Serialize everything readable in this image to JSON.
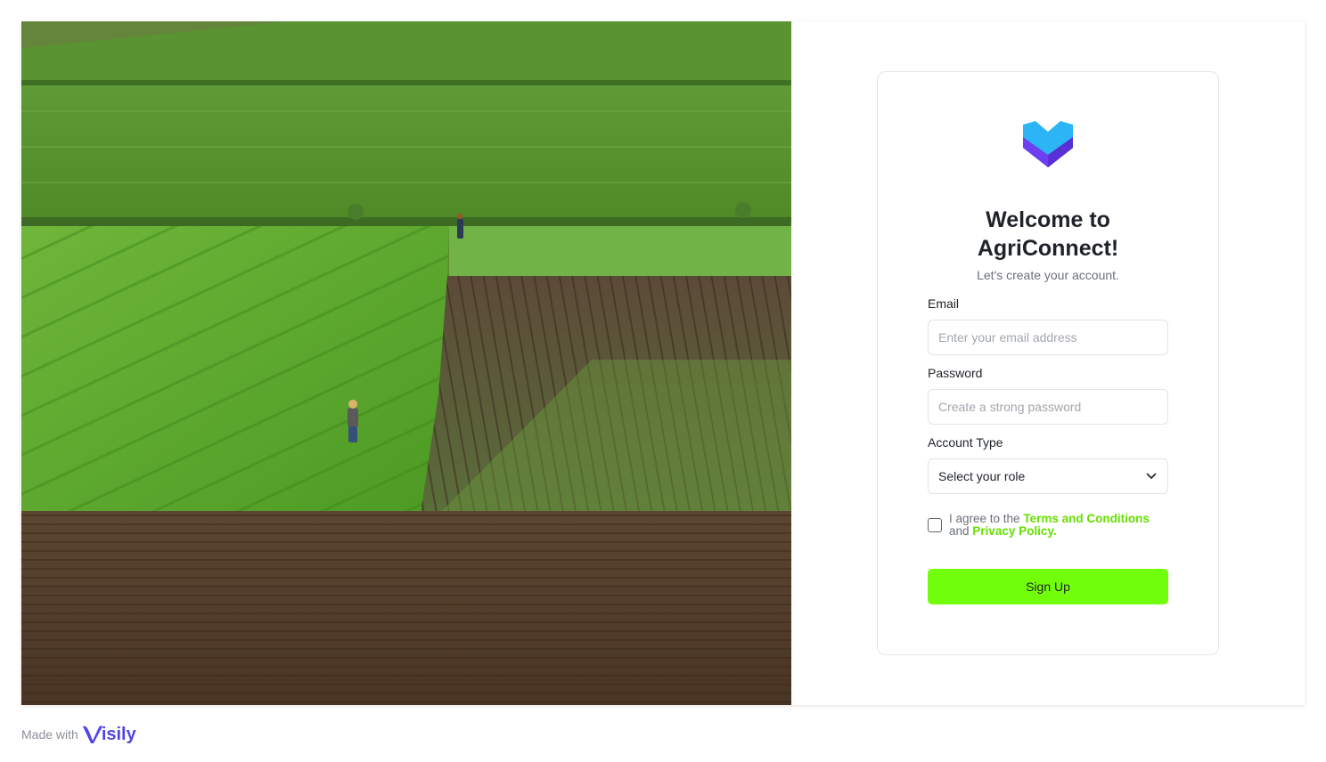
{
  "hero": {
    "image_name": "farm-field-photo"
  },
  "form": {
    "title": "Welcome to AgriConnect!",
    "subtitle": "Let's create your account.",
    "email": {
      "label": "Email",
      "placeholder": "Enter your email address"
    },
    "password": {
      "label": "Password",
      "placeholder": "Create a strong password"
    },
    "account_type": {
      "label": "Account Type",
      "selected": "Select your role"
    },
    "agree": {
      "prefix": "I agree to the",
      "terms_link": "Terms and Conditions",
      "conjunction": "and",
      "privacy_link": "Privacy Policy",
      "suffix": "."
    },
    "submit_label": "Sign Up"
  },
  "footer": {
    "made_with": "Made with",
    "brand": "isily"
  },
  "colors": {
    "accent": "#72ff0b",
    "link": "#66e000",
    "logo_blue": "#2bb5f5",
    "logo_purple": "#6d3ff0",
    "brand": "#4f46e5"
  },
  "icons": {
    "select_caret": "chevron-down-icon",
    "logo": "agriconnect-logo-icon"
  }
}
